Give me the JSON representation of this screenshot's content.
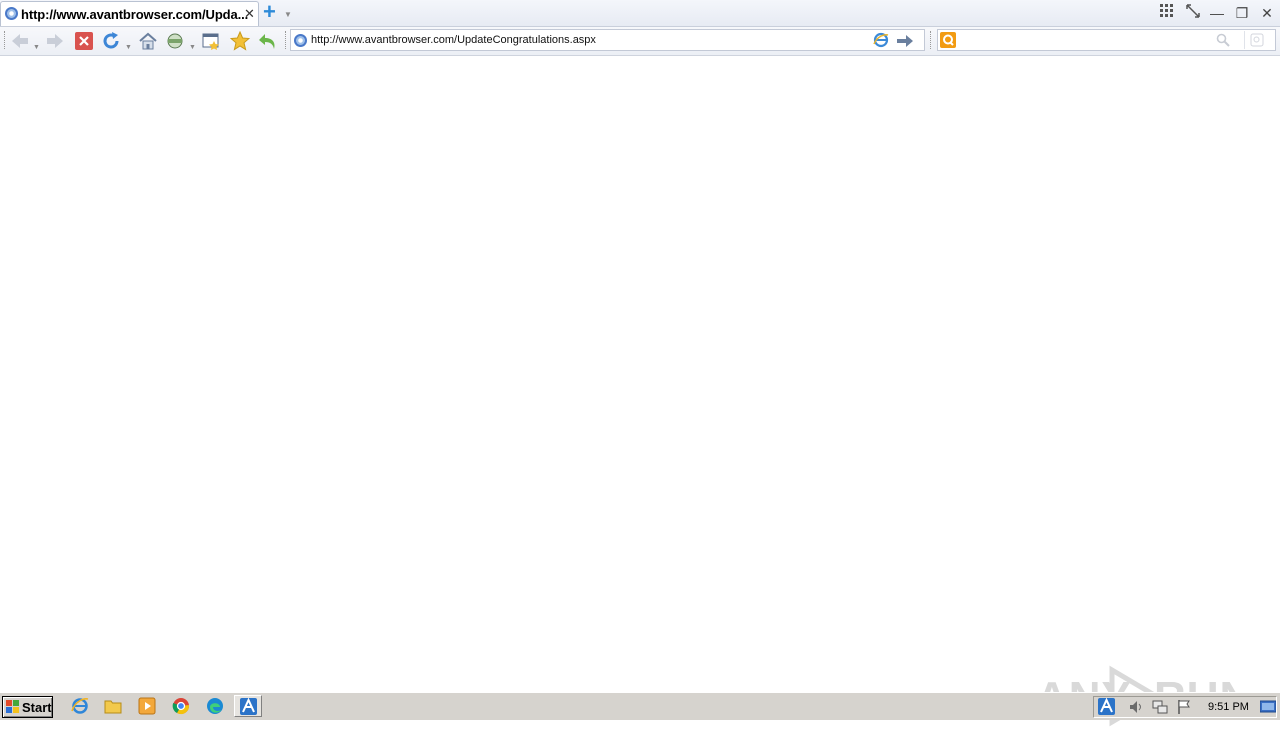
{
  "tab": {
    "title": "http://www.avantbrowser.com/Upda...",
    "close": "✕"
  },
  "window_controls": {
    "new_tab": "+",
    "apps": "grid-icon",
    "minimize": "—",
    "restore": "❐",
    "close": "✕"
  },
  "toolbar": {
    "address": "http://www.avantbrowser.com/UpdateCongratulations.aspx",
    "search_value": ""
  },
  "watermark": {
    "text": "ANY RUN"
  },
  "taskbar": {
    "start_label": "Start",
    "clock": "9:51 PM"
  },
  "colors": {
    "accent": "#2d8ad8",
    "taskbar": "#d6d3ce",
    "stop": "#d9534f",
    "star": "#f2c037"
  }
}
